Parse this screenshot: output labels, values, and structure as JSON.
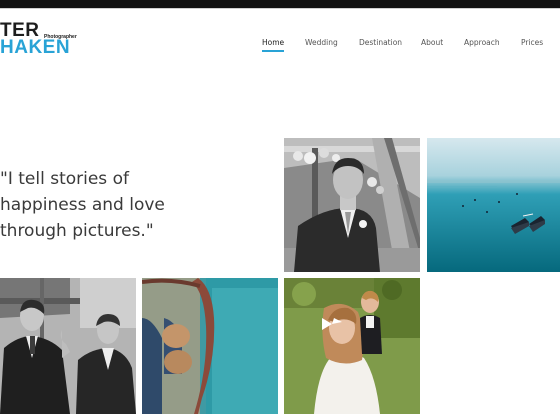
{
  "logo": {
    "line1": "TER",
    "line2": "HAKEN",
    "tagline": "Photographer"
  },
  "nav": {
    "items": [
      {
        "label": "Home",
        "active": true
      },
      {
        "label": "Wedding",
        "active": false
      },
      {
        "label": "Destination",
        "active": false
      },
      {
        "label": "About",
        "active": false
      },
      {
        "label": "Approach",
        "active": false
      },
      {
        "label": "Prices",
        "active": false
      }
    ],
    "accent": "#29a3d6"
  },
  "hero": {
    "quote_lines": [
      "\"I tell stories of",
      "happiness and love",
      "through pictures.\""
    ]
  },
  "gallery": [
    {
      "name": "groom-photo",
      "style": "black-and-white"
    },
    {
      "name": "lake-boats-photo",
      "style": "color"
    },
    {
      "name": "groomsmen-photo",
      "style": "black-and-white"
    },
    {
      "name": "shoes-photo",
      "style": "color"
    },
    {
      "name": "flower-girl-photo",
      "style": "color"
    }
  ]
}
